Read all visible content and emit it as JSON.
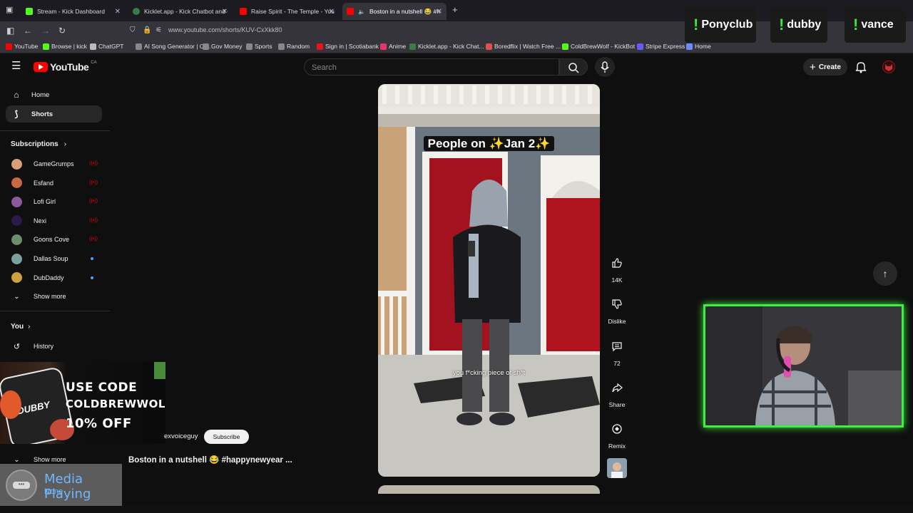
{
  "browser": {
    "tabs": [
      {
        "label": "Stream - Kick Dashboard",
        "color": "#53fc18"
      },
      {
        "label": "Kicklet.app - Kick Chatbot and C",
        "color": "#3c7a4a"
      },
      {
        "label": "Raise Spirit - The Temple - YouT",
        "color": "#ff0000"
      },
      {
        "label": "Boston in a nutshell 😂 #h",
        "color": "#ff0000"
      }
    ],
    "new_tab": "+",
    "url": "www.youtube.com/shorts/KUV-CxXkk80",
    "bookmarks": [
      {
        "label": "YouTube",
        "color": "#ff0000"
      },
      {
        "label": "Browse | kick",
        "color": "#53fc18"
      },
      {
        "label": "ChatGPT",
        "color": "#bbbbbb"
      },
      {
        "label": "AI Song Generator | Cr...",
        "color": "#888888"
      },
      {
        "label": "Gov Money",
        "color": "#888888"
      },
      {
        "label": "Sports",
        "color": "#888888"
      },
      {
        "label": "Random",
        "color": "#888888"
      },
      {
        "label": "Sign in | Scotiabank",
        "color": "#ec111a"
      },
      {
        "label": "Anime",
        "color": "#e8336d"
      },
      {
        "label": "Kicklet.app - Kick Chat...",
        "color": "#3c7a4a"
      },
      {
        "label": "Boredflix | Watch Free ...",
        "color": "#e05050"
      },
      {
        "label": "ColdBrewWolf - KickBot",
        "color": "#53fc18"
      },
      {
        "label": "Stripe Express",
        "color": "#635bff"
      },
      {
        "label": "Home",
        "color": "#6a8cff"
      }
    ]
  },
  "overlays": {
    "names": [
      "Ponyclub",
      "dubby",
      "vance"
    ],
    "bang": "!"
  },
  "youtube": {
    "logo": "YouTube",
    "country": "CA",
    "search_placeholder": "Search",
    "create_label": "Create",
    "sidebar": {
      "home": "Home",
      "shorts": "Shorts",
      "subscriptions_header": "Subscriptions",
      "subscriptions": [
        {
          "name": "GameGrumps",
          "color": "#d8a07a",
          "status": "live"
        },
        {
          "name": "Esfand",
          "color": "#c76a3f",
          "status": "live"
        },
        {
          "name": "Lofi Girl",
          "color": "#8a5a9a",
          "status": "live"
        },
        {
          "name": "Nexi",
          "color": "#2a1a4a",
          "status": "live"
        },
        {
          "name": "Goons Cove",
          "color": "#6b8e6b",
          "status": "live"
        },
        {
          "name": "Dallas Soup",
          "color": "#7aa0a0",
          "status": "new"
        },
        {
          "name": "DubDaddy",
          "color": "#d0a040",
          "status": "new"
        }
      ],
      "show_more": "Show more",
      "you_header": "You",
      "history": "History",
      "show_more_2": "Show more"
    },
    "short": {
      "caption_overlay": "People on ✨Jan 2✨",
      "subtitle": "you f*cking piece of sh*t",
      "channel": "exvoiceguy",
      "subscribe": "Subscribe",
      "title": "Boston in a nutshell 😂 #happynewyear ...",
      "likes": "14K",
      "dislike_label": "Dislike",
      "comments": "72",
      "share_label": "Share",
      "remix_label": "Remix"
    }
  },
  "promo": {
    "line1": "USE CODE",
    "line2": "COLDBREWWOLF",
    "line3": "10% OFF",
    "brand": "DUBBY"
  },
  "media": {
    "title": "Media Playing",
    "status": "None"
  }
}
